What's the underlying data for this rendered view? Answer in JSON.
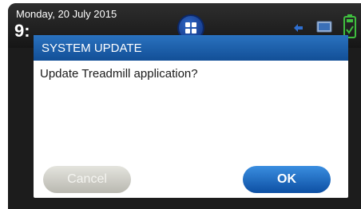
{
  "status_bar": {
    "date": "Monday, 20 July 2015",
    "time": "9:"
  },
  "icons": {
    "home": "grid-home-icon",
    "back": "back-arrow-icon",
    "screen": "monitor-icon",
    "battery": "battery-check-icon"
  },
  "dialog": {
    "title": "SYSTEM UPDATE",
    "message": "Update Treadmill application?",
    "cancel_label": "Cancel",
    "ok_label": "OK"
  },
  "colors": {
    "header_blue": "#124f97",
    "ok_blue": "#0d4fa3",
    "cancel_gray": "#b9b8b0",
    "status_bg": "#1c1c1c",
    "battery_green": "#3fbf3f"
  }
}
